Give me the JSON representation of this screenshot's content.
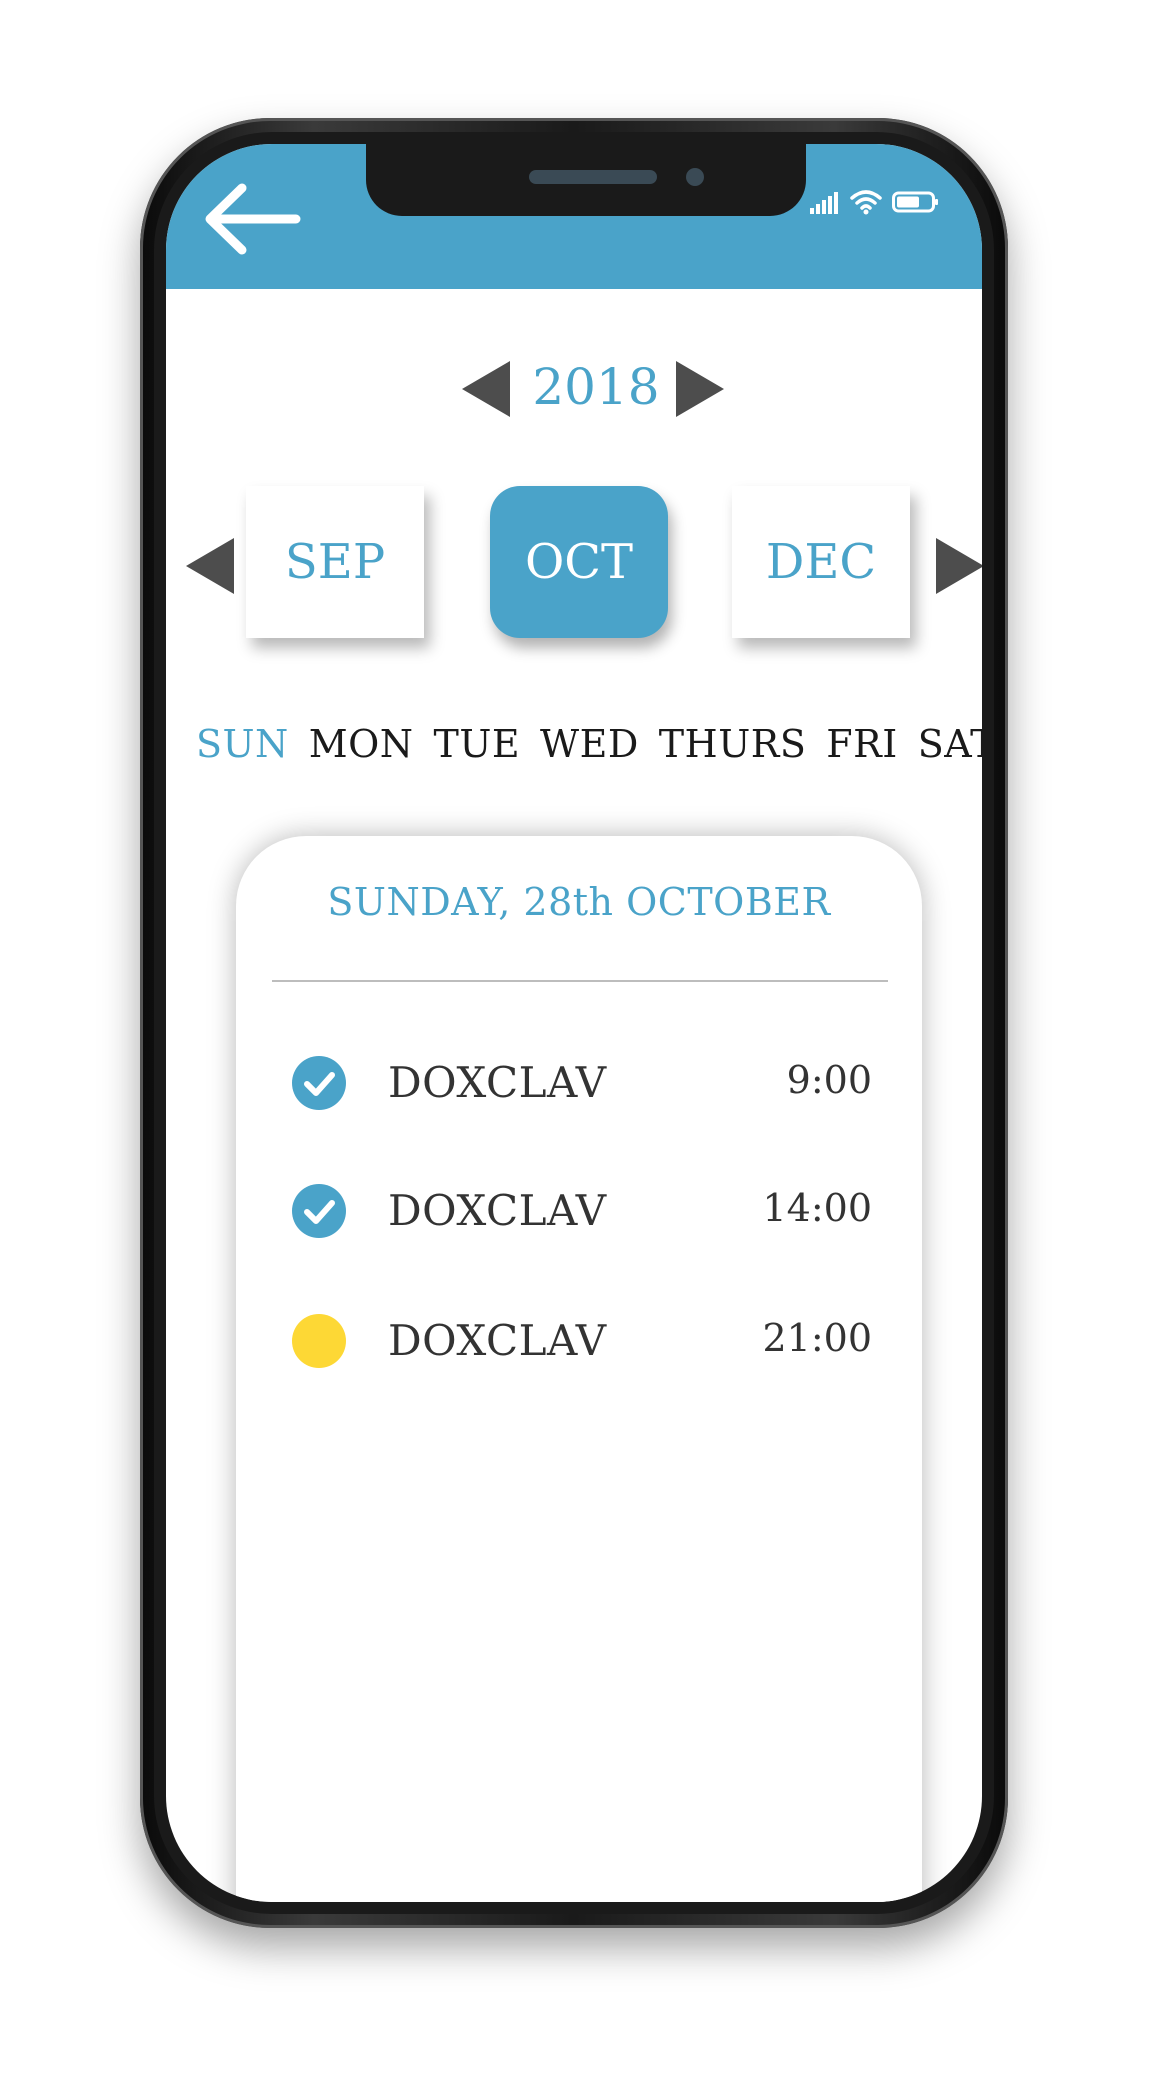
{
  "header": {
    "accent_color": "#4aa3c9",
    "back_icon": "back-arrow-icon",
    "status_icons": [
      "signal-icon",
      "wifi-icon",
      "battery-icon"
    ]
  },
  "year_selector": {
    "year": "2018",
    "prev_icon": "triangle-left-icon",
    "next_icon": "triangle-right-icon"
  },
  "month_selector": {
    "prev_month": "SEP",
    "current_month": "OCT",
    "next_month": "DEC",
    "prev_icon": "triangle-left-icon",
    "next_icon": "triangle-right-icon"
  },
  "weekdays": {
    "active": "SUN",
    "items": [
      "SUN",
      "MON",
      "TUE",
      "WED",
      "THURS",
      "FRI",
      "SAT"
    ]
  },
  "day_card": {
    "title": "SUNDAY, 28th OCTOBER",
    "medications": [
      {
        "name": "DOXCLAV",
        "time": "9:00",
        "status": "done",
        "icon": "check-circle-icon"
      },
      {
        "name": "DOXCLAV",
        "time": "14:00",
        "status": "done",
        "icon": "check-circle-icon"
      },
      {
        "name": "DOXCLAV",
        "time": "21:00",
        "status": "pending",
        "icon": "pending-dot-icon"
      }
    ],
    "done_color": "#4aa3c9",
    "pending_color": "#fdd835"
  }
}
